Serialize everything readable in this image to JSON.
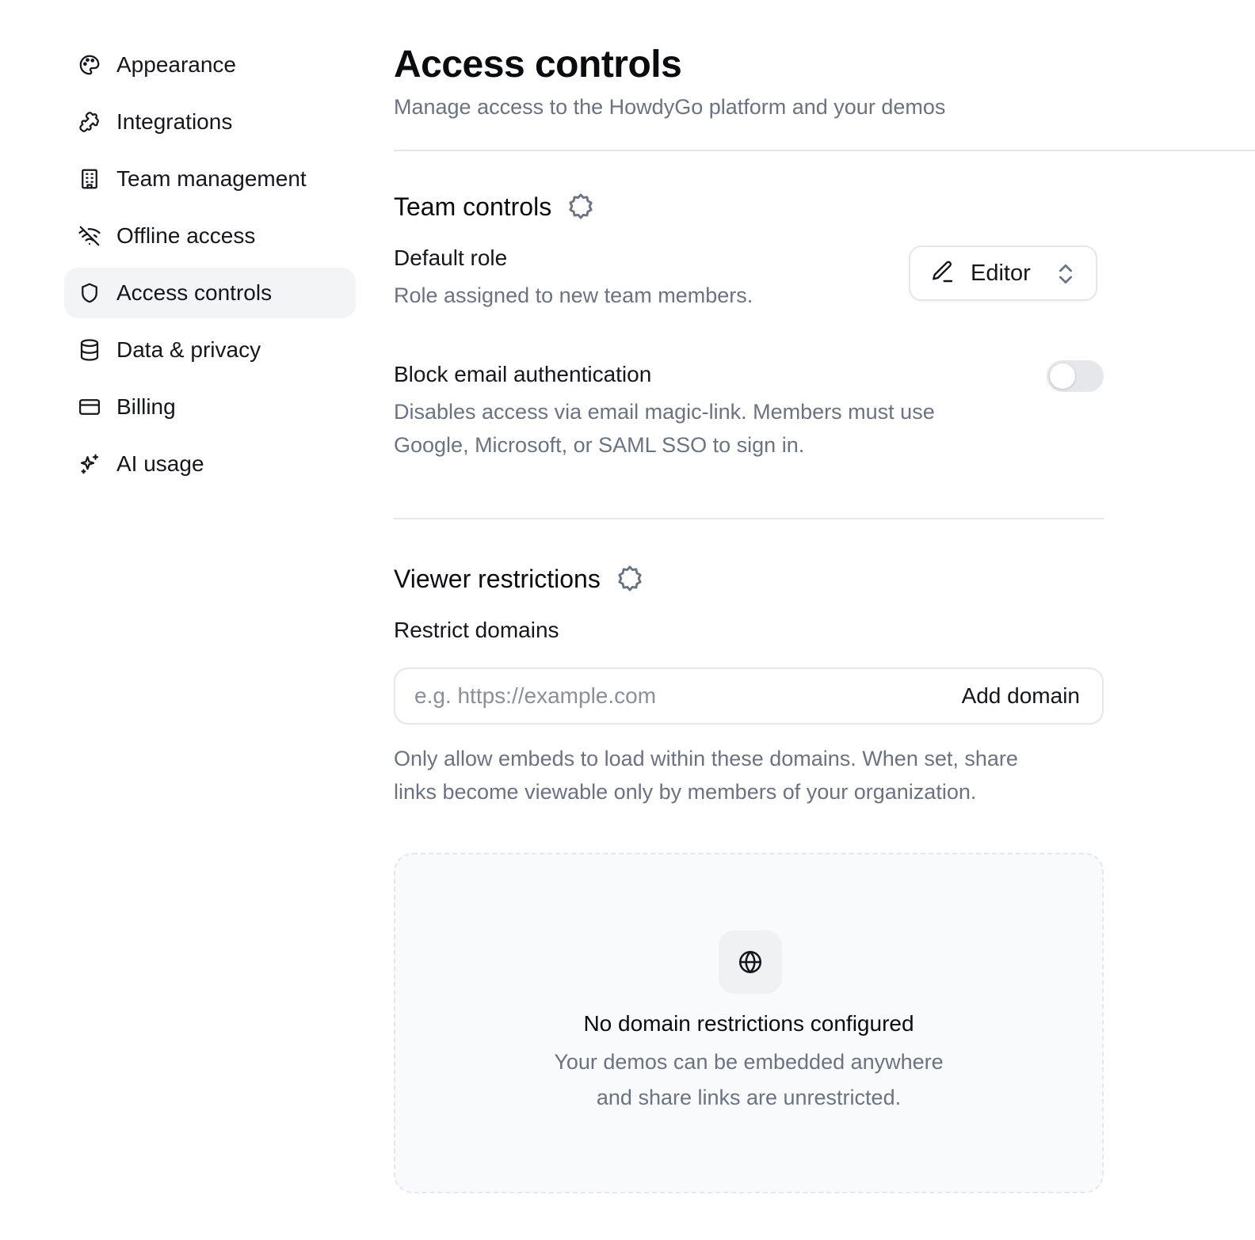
{
  "sidebar": {
    "items": [
      {
        "label": "Appearance",
        "icon": "palette-icon"
      },
      {
        "label": "Integrations",
        "icon": "puzzle-icon"
      },
      {
        "label": "Team management",
        "icon": "building-icon"
      },
      {
        "label": "Offline access",
        "icon": "wifi-off-icon"
      },
      {
        "label": "Access controls",
        "icon": "shield-icon",
        "active": true
      },
      {
        "label": "Data & privacy",
        "icon": "database-icon"
      },
      {
        "label": "Billing",
        "icon": "credit-card-icon"
      },
      {
        "label": "AI usage",
        "icon": "sparkles-icon"
      }
    ]
  },
  "header": {
    "title": "Access controls",
    "subtitle": "Manage access to the HowdyGo platform and your demos"
  },
  "team_controls": {
    "title": "Team controls",
    "badge_icon": "badge-icon",
    "default_role": {
      "label": "Default role",
      "description": "Role assigned to new team members.",
      "value": "Editor"
    },
    "block_email": {
      "label": "Block email authentication",
      "description_line1": "Disables access via email magic-link. Members must use",
      "description_line2": "Google, Microsoft, or SAML SSO to sign in.",
      "enabled": false
    }
  },
  "viewer_restrictions": {
    "title": "Viewer restrictions",
    "badge_icon": "badge-icon",
    "restrict_domains": {
      "label": "Restrict domains",
      "placeholder": "e.g. https://example.com",
      "value": "",
      "add_label": "Add domain",
      "help_line1": "Only allow embeds to load within these domains. When set, share",
      "help_line2": "links become viewable only by members of your organization."
    },
    "empty_state": {
      "icon": "globe-icon",
      "title": "No domain restrictions configured",
      "line1": "Your demos can be embedded anywhere",
      "line2": "and share links are unrestricted."
    }
  },
  "colors": {
    "text": "#0b0c10",
    "muted": "#6b7280",
    "border": "#e5e7eb",
    "active_bg": "#f3f4f6"
  }
}
